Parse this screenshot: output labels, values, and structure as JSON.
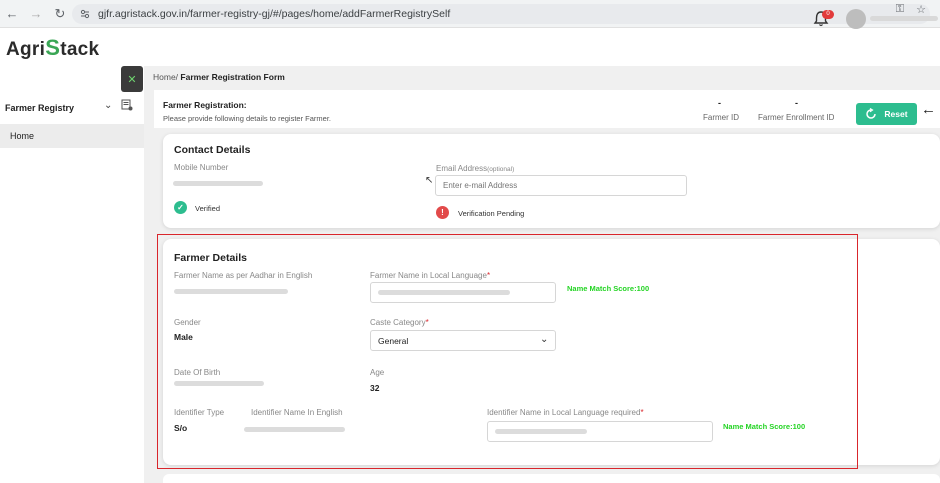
{
  "browser": {
    "url": "gjfr.agristack.gov.in/farmer-registry-gj/#/pages/home/addFarmerRegistrySelf"
  },
  "header": {
    "logo_left": "Agri",
    "logo_s": "S",
    "logo_right": "tack",
    "notification_count": "0"
  },
  "sidebar": {
    "section_label": "Farmer Registry",
    "items": [
      {
        "label": "Home"
      }
    ]
  },
  "breadcrumb": {
    "home": "Home/",
    "current": "Farmer Registration Form"
  },
  "registration": {
    "title": "Farmer Registration:",
    "subtitle": "Please provide following details to register Farmer.",
    "farmer_id_value": "-",
    "farmer_id_label": "Farmer ID",
    "enrollment_id_value": "-",
    "enrollment_id_label": "Farmer Enrollment ID",
    "reset_label": "Reset"
  },
  "contact": {
    "title": "Contact Details",
    "mobile_label": "Mobile Number",
    "mobile_status": "Verified",
    "email_label": "Email Address",
    "email_optional": "(optional)",
    "email_placeholder": "Enter e-mail Address",
    "email_status": "Verification Pending"
  },
  "farmer": {
    "title": "Farmer Details",
    "name_aadhar_label": "Farmer Name as per Aadhar in English",
    "name_local_label": "Farmer Name in Local Language",
    "name_match_score": "Name Match Score:100",
    "gender_label": "Gender",
    "gender_value": "Male",
    "caste_label": "Caste Category",
    "caste_value": "General",
    "dob_label": "Date Of Birth",
    "age_label": "Age",
    "age_value": "32",
    "identifier_type_label": "Identifier Type",
    "identifier_type_value": "S/o",
    "identifier_name_label": "Identifier Name In English",
    "identifier_local_label": "Identifier Name in Local Language required",
    "identifier_match_score": "Name Match Score:100"
  },
  "colors": {
    "accent": "#2dbd8f",
    "verified": "#2dbd8f",
    "pending": "#e24a4a",
    "score": "#24d424",
    "highlight": "#d9262c"
  }
}
